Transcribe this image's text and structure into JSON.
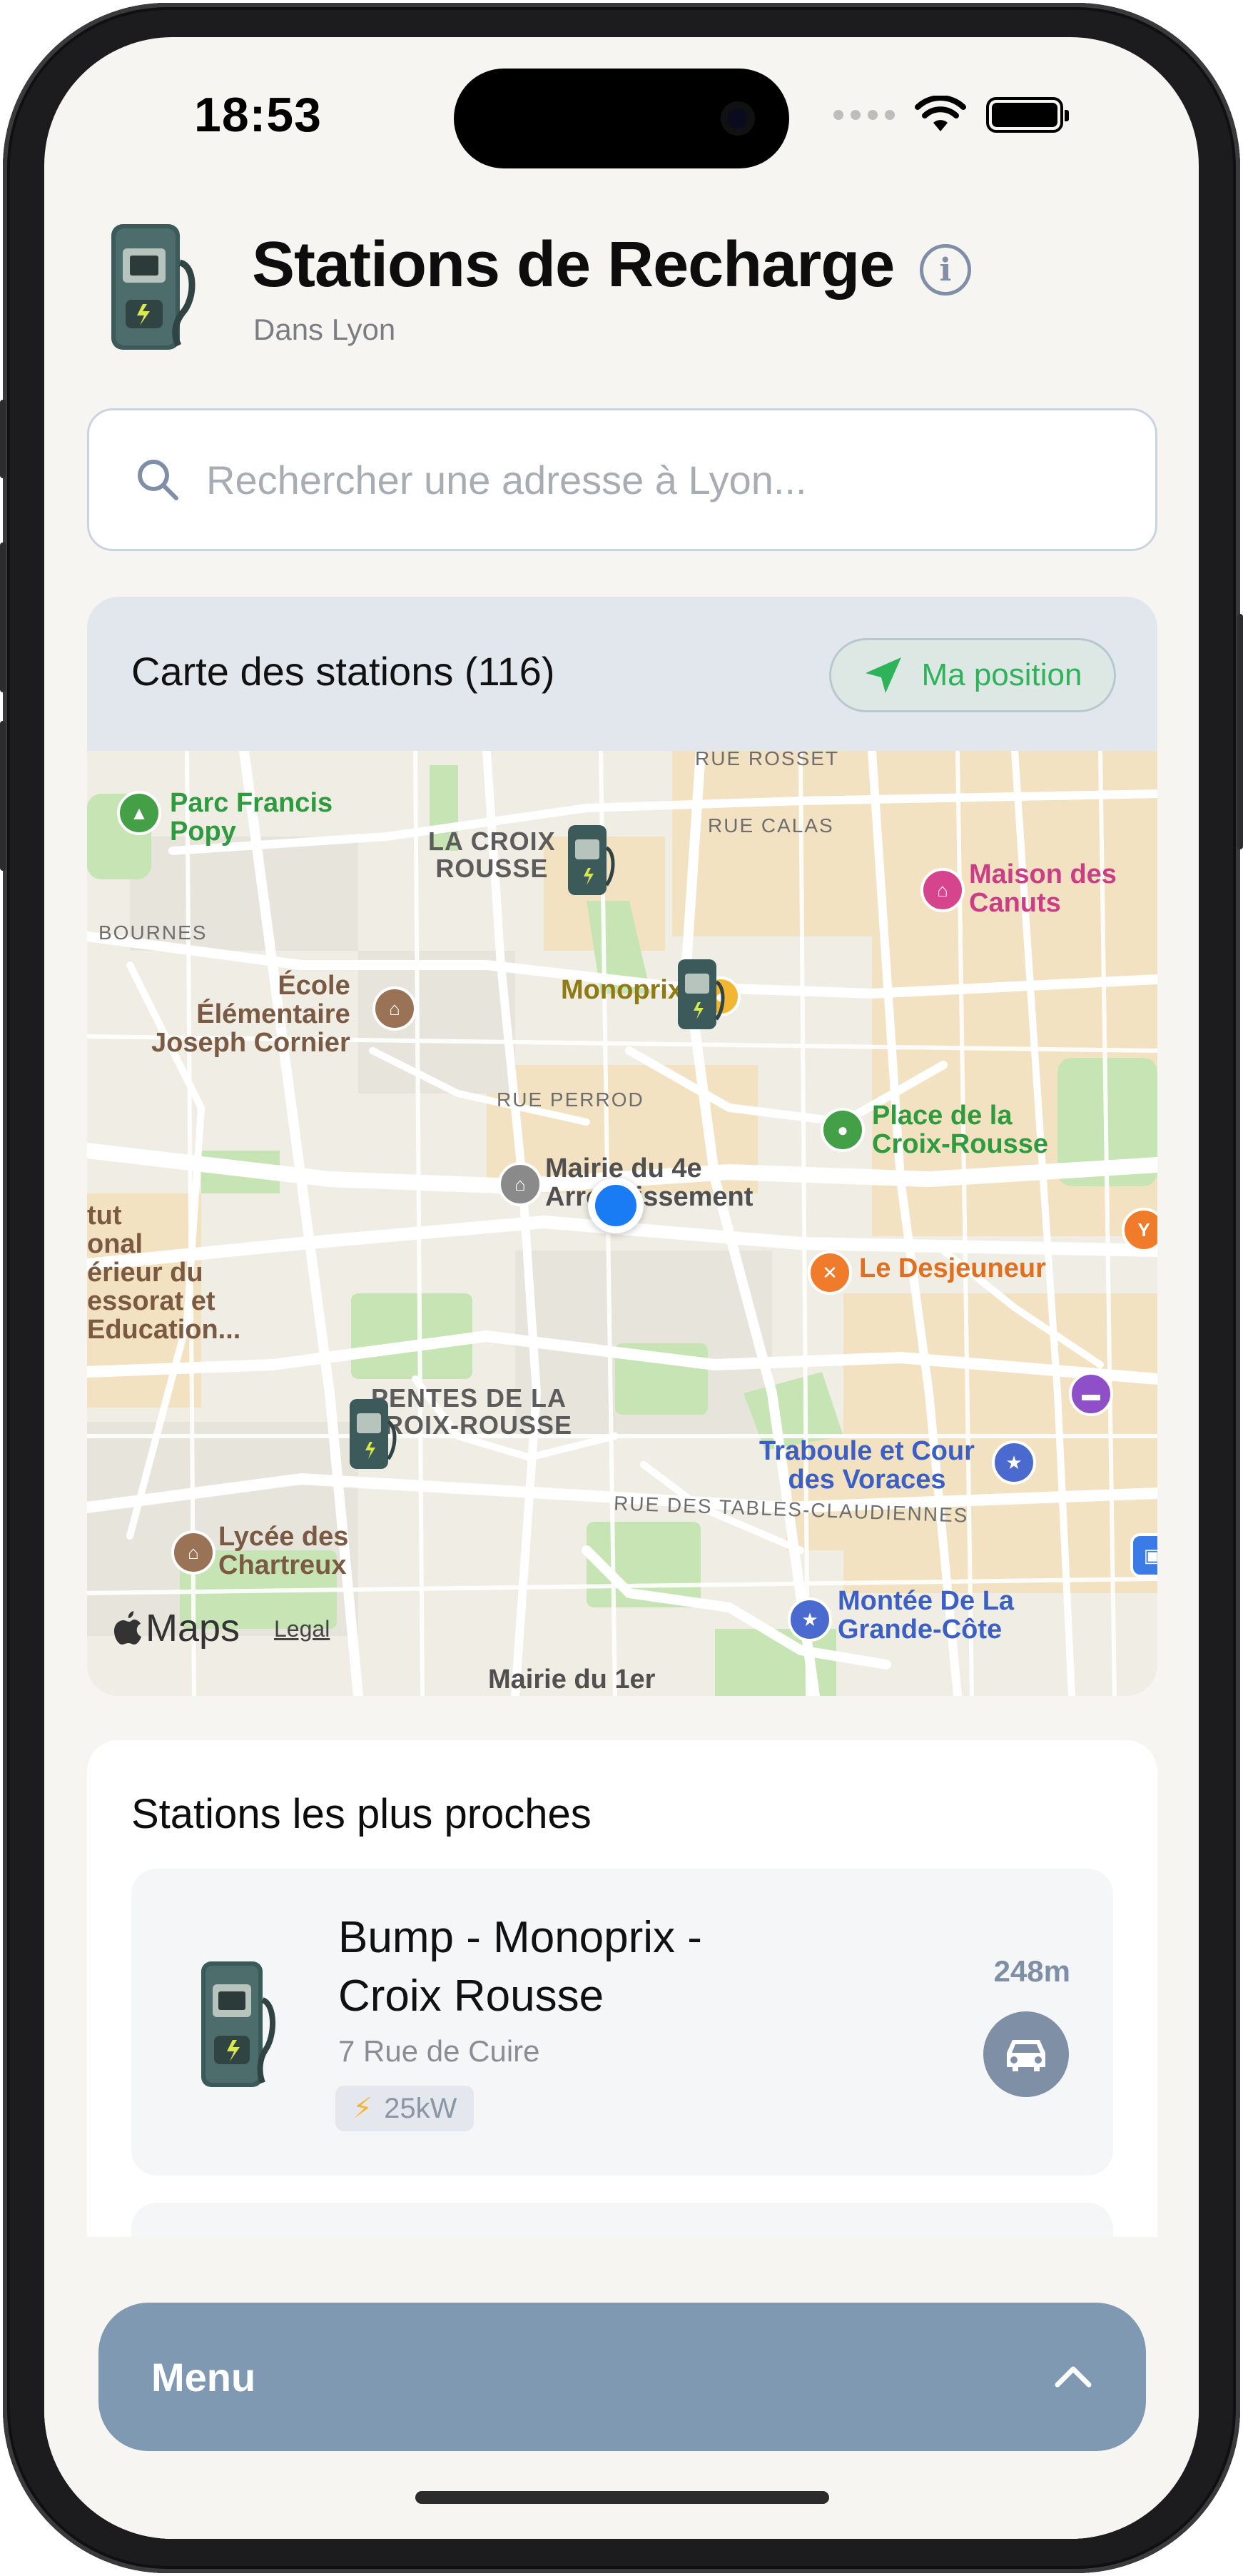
{
  "status_bar": {
    "time": "18:53"
  },
  "header": {
    "title": "Stations de Recharge",
    "subtitle": "Dans Lyon",
    "info_icon": "info-circle-icon"
  },
  "search": {
    "placeholder": "Rechercher une adresse à Lyon...",
    "value": ""
  },
  "map_card": {
    "title": "Carte des stations (116)",
    "my_position_label": "Ma position",
    "attribution": "Maps",
    "legal": "Legal",
    "labels": {
      "rue_rosset": "RUE ROSSET",
      "rue_calas": "RUE CALAS",
      "la_croix_rousse": "LA CROIX\nROUSSE",
      "bournes": "BOURNES",
      "rue_perrod": "RUE PERROD",
      "pentes": "PENTES DE LA\nCROIX-ROUSSE",
      "rue_tables": "RUE DES TABLES-CLAUDIENNES",
      "parc_francis": "Parc Francis\nPopy",
      "maison_canuts": "Maison des\nCanuts",
      "ecole": "École\nÉlémentaire\nJoseph Cornier",
      "monoprix": "Monoprix",
      "place_croix_rousse": "Place de la\nCroix-Rousse",
      "mairie_4e": "Mairie du 4e\nArrondissement",
      "le_desjeuneur": "Le Desjeuneur",
      "institut": "tut\nonal\nérieur du\nessorat et\nEducation...",
      "traboule": "Traboule et Cour\ndes Voraces",
      "lycee": "Lycée des\nChartreux",
      "montee": "Montée De La\nGrande-Côte",
      "mairie_1er": "Mairie du 1er"
    }
  },
  "nearest": {
    "title": "Stations les plus proches",
    "items": [
      {
        "name": "Bump - Monoprix - Croix Rousse",
        "address": "7 Rue de Cuire",
        "power": "25kW",
        "distance": "248m"
      }
    ]
  },
  "menu": {
    "label": "Menu",
    "icon": "chevron-up-icon"
  },
  "colors": {
    "background": "#f6f5f1",
    "accent": "#7f99b3",
    "position_green": "#2fb35a",
    "user_location": "#1a7cf5"
  }
}
